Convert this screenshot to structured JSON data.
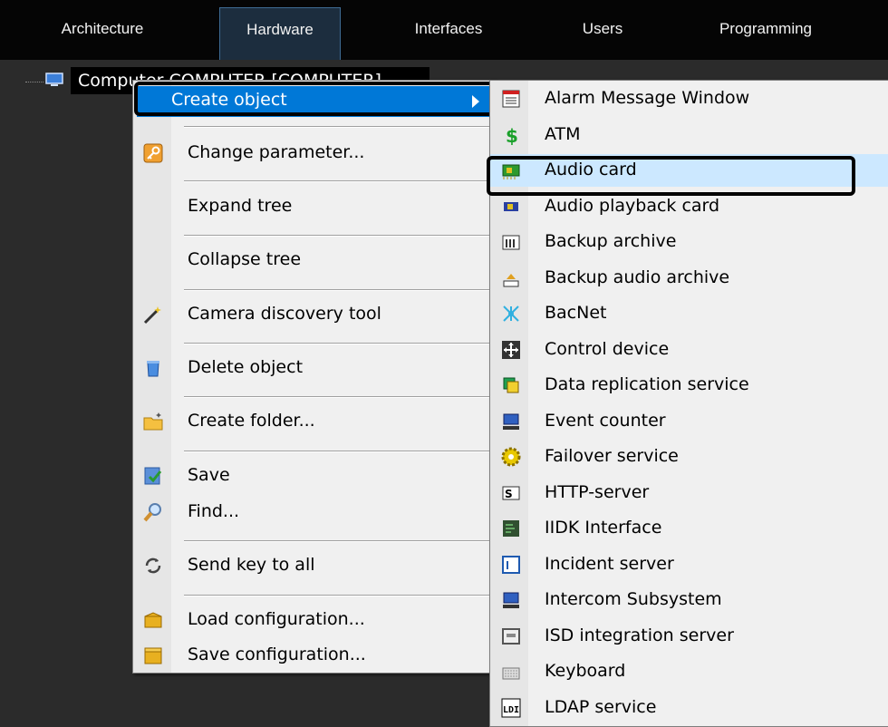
{
  "tabs": [
    "Architecture",
    "Hardware",
    "Interfaces",
    "Users",
    "Programming"
  ],
  "active_tab": "Hardware",
  "tree": {
    "node_label": "Computer COMPUTER [COMPUTER]"
  },
  "context_menu": {
    "create_object": "Create object",
    "items": [
      "Change parameter...",
      "Expand tree",
      "Collapse tree",
      "Camera discovery tool",
      "Delete object",
      "Create folder...",
      "Save",
      "Find...",
      "Send key to all",
      "Load configuration...",
      "Save configuration..."
    ]
  },
  "submenu": {
    "items": [
      "Alarm Message Window",
      "ATM",
      "Audio card",
      "Audio playback card",
      "Backup archive",
      "Backup audio archive",
      "BacNet",
      "Control device",
      "Data replication service",
      "Event counter",
      "Failover service",
      "HTTP-server",
      "IIDK Interface",
      "Incident server",
      "Intercom Subsystem",
      "ISD integration server",
      "Keyboard",
      "LDAP service"
    ],
    "highlighted": "Audio card"
  },
  "colors": {
    "selection": "#0078d7",
    "hover": "#cce8ff",
    "tab_active": "#1c2d3e"
  }
}
